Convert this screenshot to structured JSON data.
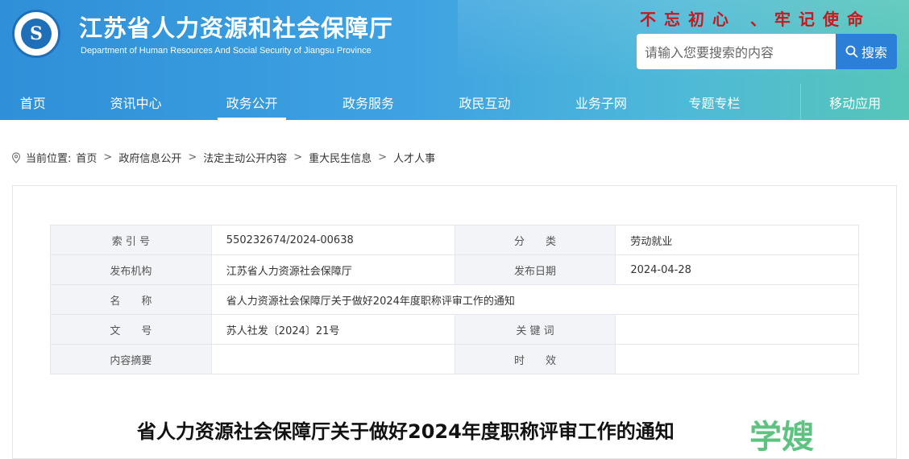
{
  "header": {
    "site_title": "江苏省人力资源和社会保障厅",
    "site_subtitle": "Department of Human Resources And Social Security of Jiangsu Province",
    "slogan": "不忘初心 、牢记使命",
    "search_placeholder": "请输入您要搜索的内容",
    "search_button": "搜索",
    "colors": {
      "brand_blue": "#2f8fd8",
      "slogan_red": "#c9171e"
    }
  },
  "nav": {
    "items": [
      {
        "label": "首页"
      },
      {
        "label": "资讯中心"
      },
      {
        "label": "政务公开"
      },
      {
        "label": "政务服务"
      },
      {
        "label": "政民互动"
      },
      {
        "label": "业务子网"
      },
      {
        "label": "专题专栏"
      },
      {
        "label": "移动应用"
      }
    ],
    "active": "政务公开"
  },
  "breadcrumb": {
    "prefix": "当前位置:",
    "items": [
      "首页",
      "政府信息公开",
      "法定主动公开内容",
      "重大民生信息",
      "人才人事"
    ]
  },
  "meta": {
    "rows": [
      {
        "k1": "索 引 号",
        "v1": "550232674/2024-00638",
        "k2": "分　　类",
        "v2": "劳动就业"
      },
      {
        "k1": "发布机构",
        "v1": "江苏省人力资源社会保障厅",
        "k2": "发布日期",
        "v2": "2024-04-28"
      },
      {
        "k1": "名　　称",
        "v1": "省人力资源社会保障厅关于做好2024年度职称评审工作的通知"
      },
      {
        "k1": "文　　号",
        "v1": "苏人社发〔2024〕21号",
        "k2": "关 键 词",
        "v2": ""
      },
      {
        "k1": "内容摘要",
        "v1": "",
        "k2": "时　　效",
        "v2": ""
      }
    ]
  },
  "document": {
    "title": "省人力资源社会保障厅关于做好2024年度职称评审工作的通知"
  },
  "watermark": "学嫂"
}
